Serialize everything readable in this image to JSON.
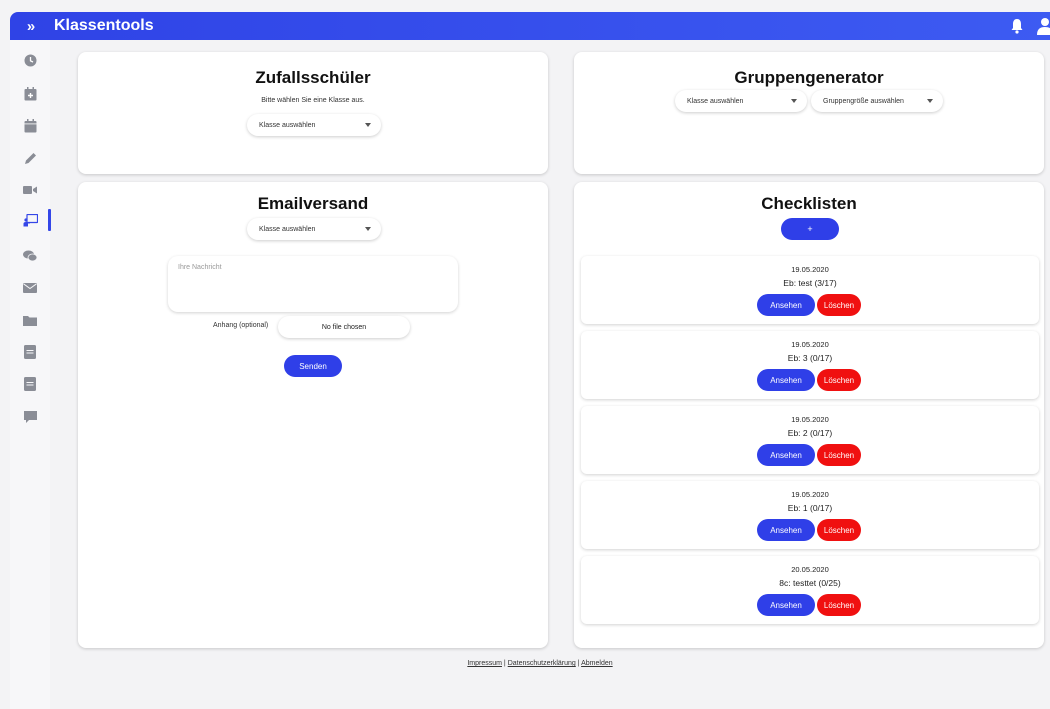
{
  "header": {
    "toggle": "»",
    "title": "Klassentools",
    "icons": [
      "bell-icon",
      "user-icon"
    ]
  },
  "sidebar": {
    "items": [
      {
        "icon": "clock-icon"
      },
      {
        "icon": "calendar-add-icon"
      },
      {
        "icon": "calendar-icon"
      },
      {
        "icon": "pencil-icon"
      },
      {
        "icon": "video-icon"
      },
      {
        "icon": "presentation-icon",
        "active": true
      },
      {
        "icon": "chat-icon"
      },
      {
        "icon": "mail-icon"
      },
      {
        "icon": "folder-icon"
      },
      {
        "icon": "book-icon"
      },
      {
        "icon": "book-icon"
      },
      {
        "icon": "comment-icon"
      }
    ]
  },
  "zufall": {
    "title": "Zufallsschüler",
    "hint": "Bitte wählen Sie eine Klasse aus.",
    "select": "Klasse auswählen"
  },
  "gruppen": {
    "title": "Gruppengenerator",
    "select_class": "Klasse auswählen",
    "select_size": "Gruppengröße auswählen"
  },
  "email": {
    "title": "Emailversand",
    "select": "Klasse auswählen",
    "message_placeholder": "Ihre Nachricht",
    "attachment_label": "Anhang (optional)",
    "file_button": "No file chosen",
    "send": "Senden"
  },
  "checklisten": {
    "title": "Checklisten",
    "add": "+",
    "view_label": "Ansehen",
    "delete_label": "Löschen",
    "items": [
      {
        "date": "19.05.2020",
        "name": "Eb: test (3/17)"
      },
      {
        "date": "19.05.2020",
        "name": "Eb: 3 (0/17)"
      },
      {
        "date": "19.05.2020",
        "name": "Eb: 2 (0/17)"
      },
      {
        "date": "19.05.2020",
        "name": "Eb: 1 (0/17)"
      },
      {
        "date": "20.05.2020",
        "name": "8c: testtet (0/25)"
      }
    ]
  },
  "footer": {
    "impressum": "Impressum",
    "sep1": " | ",
    "datenschutz": "Datenschutzerklärung",
    "sep2": " | ",
    "abmelden": "Abmelden"
  },
  "colors": {
    "primary": "#2f3fe8",
    "danger": "#f01010",
    "sidebar_icon": "#8a8d96"
  }
}
